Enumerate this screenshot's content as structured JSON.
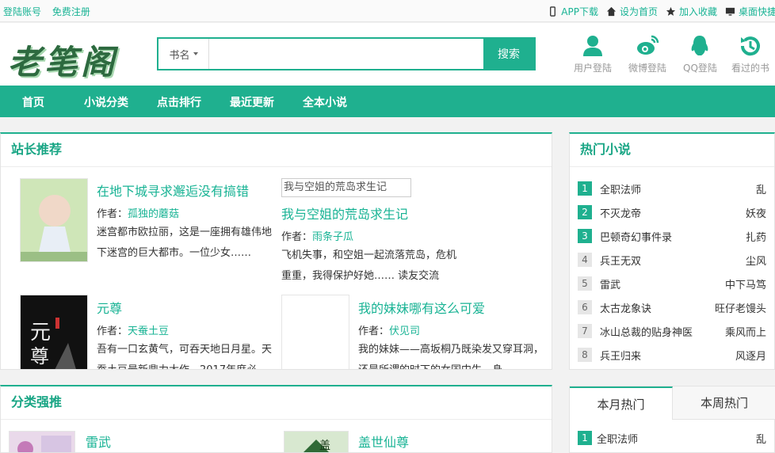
{
  "topbar": {
    "login": "登陆账号",
    "register": "免费注册",
    "app": "APP下载",
    "home": "设为首页",
    "fav": "加入收藏",
    "desktop": "桌面快捷"
  },
  "header": {
    "logo": "老笔阁",
    "search": {
      "select": "书名",
      "placeholder": "",
      "button": "搜索"
    },
    "quick": [
      {
        "label": "用户登陆",
        "icon": "user-icon"
      },
      {
        "label": "微博登陆",
        "icon": "weibo-icon"
      },
      {
        "label": "QQ登陆",
        "icon": "qq-icon"
      },
      {
        "label": "看过的书",
        "icon": "history-icon"
      }
    ]
  },
  "nav": [
    "首页",
    "小说分类",
    "点击排行",
    "最近更新",
    "全本小说"
  ],
  "recommend": {
    "title": "站长推荐",
    "books": [
      {
        "title": "在地下城寻求邂逅没有搞错",
        "author_label": "作者：",
        "author": "孤独的蘑菇",
        "desc": "迷宫都市欧拉丽，这是一座拥有雄伟地下迷宫的巨大都市。一位少女……"
      },
      {
        "title": "我与空姐的荒岛求生记",
        "cover_alt": "我与空姐的荒岛求生记",
        "author_label": "作者：",
        "author": "雨条子瓜",
        "desc": "飞机失事，和空姐一起流落荒岛，危机重重，我得保护好她…… 读友交流"
      },
      {
        "title": "元尊",
        "author_label": "作者：",
        "author": "天蚕土豆",
        "desc": "吾有一口玄黄气，可吞天地日月星。天蚕土豆最新鼎力大作，2017年度必"
      },
      {
        "title": "我的妹妹哪有这么可爱",
        "author_label": "作者：",
        "author": "伏见司",
        "desc": "我的妹妹——高坂桐乃既染发又穿耳洞，还是所谓的时下的女国中生，身"
      }
    ]
  },
  "hot": {
    "title": "热门小说",
    "items": [
      {
        "rank": "1",
        "name": "全职法师",
        "author": "乱"
      },
      {
        "rank": "2",
        "name": "不灭龙帝",
        "author": "妖夜"
      },
      {
        "rank": "3",
        "name": "巴顿奇幻事件录",
        "author": "扎药"
      },
      {
        "rank": "4",
        "name": "兵王无双",
        "author": "尘风"
      },
      {
        "rank": "5",
        "name": "雷武",
        "author": "中下马笃"
      },
      {
        "rank": "6",
        "name": "太古龙象诀",
        "author": "旺仔老馒头"
      },
      {
        "rank": "7",
        "name": "冰山总裁的贴身神医",
        "author": "乘风而上"
      },
      {
        "rank": "8",
        "name": "兵王归来",
        "author": "风逐月"
      }
    ]
  },
  "category": {
    "title": "分类强推",
    "books": [
      {
        "title": "雷武"
      },
      {
        "title": "盖世仙尊"
      }
    ]
  },
  "month_tabs": {
    "tabs": [
      "本月热门",
      "本周热门"
    ],
    "items": [
      {
        "rank": "1",
        "name": "全职法师",
        "author": "乱"
      }
    ]
  },
  "colors": {
    "accent": "#1fb08f",
    "link": "#18b394"
  }
}
